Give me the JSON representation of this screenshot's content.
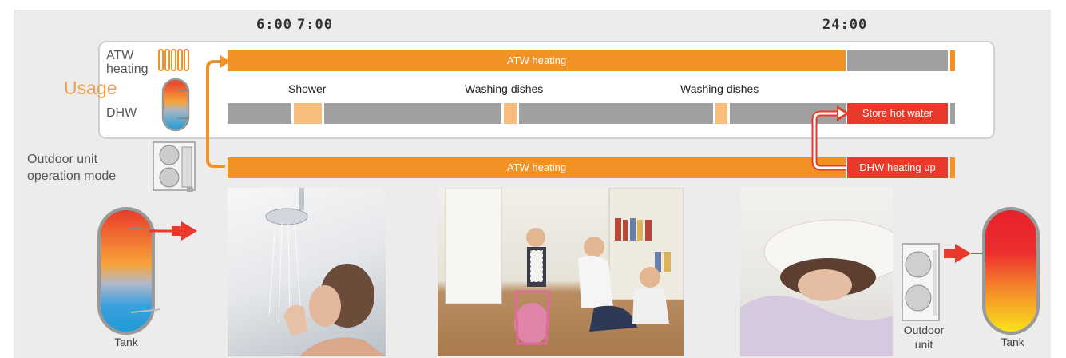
{
  "times": {
    "t1": "6:00",
    "t2": "7:00",
    "t3": "24:00"
  },
  "labels": {
    "usage": "Usage",
    "atw_heating_line1": "ATW",
    "atw_heating_line2": "heating",
    "dhw": "DHW",
    "outdoor_line1": "Outdoor unit",
    "outdoor_line2": "operation mode"
  },
  "bars": {
    "atw_top": "ATW heating",
    "atw_bottom": "ATW heating",
    "store_hot_water": "Store hot water",
    "dhw_heating_up": "DHW heating up"
  },
  "events": {
    "shower": "Shower",
    "dishes1": "Washing dishes",
    "dishes2": "Washing dishes"
  },
  "captions": {
    "tank_left": "Tank",
    "outdoor_unit_line1": "Outdoor",
    "outdoor_unit_line2": "unit",
    "tank_right": "Tank"
  },
  "colors": {
    "orange": "#f39224",
    "light_orange": "#f9be7c",
    "gray": "#a0a0a0",
    "red": "#e8392a",
    "usage_text": "#f4a24a"
  }
}
